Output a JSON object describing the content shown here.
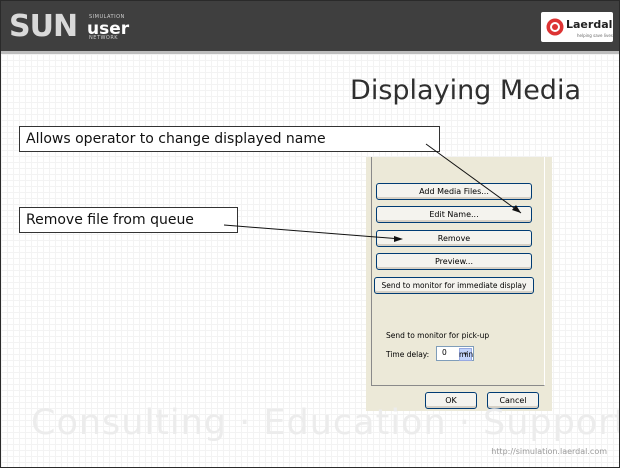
{
  "header": {
    "logo_letters": "SUN",
    "logo_small_top": "SIMULATION",
    "logo_word": "user",
    "logo_small_bottom": "NETWORK",
    "brand_name": "Laerdal",
    "brand_tagline": "helping save lives"
  },
  "slide": {
    "title": "Displaying Media",
    "callouts": [
      "Allows operator to change displayed name",
      "Remove file from queue"
    ],
    "watermark": "Consulting  ·  Education  ·  Support",
    "footer_url": "http://simulation.laerdal.com"
  },
  "dialog": {
    "buttons": {
      "add": "Add Media Files...",
      "edit": "Edit Name...",
      "remove": "Remove",
      "preview": "Preview...",
      "send": "Send to monitor for immediate display"
    },
    "pickup_label": "Send to monitor for pick-up",
    "time_delay_label": "Time delay:",
    "time_delay_value": "0",
    "time_unit": "min",
    "ok": "OK",
    "cancel": "Cancel"
  }
}
